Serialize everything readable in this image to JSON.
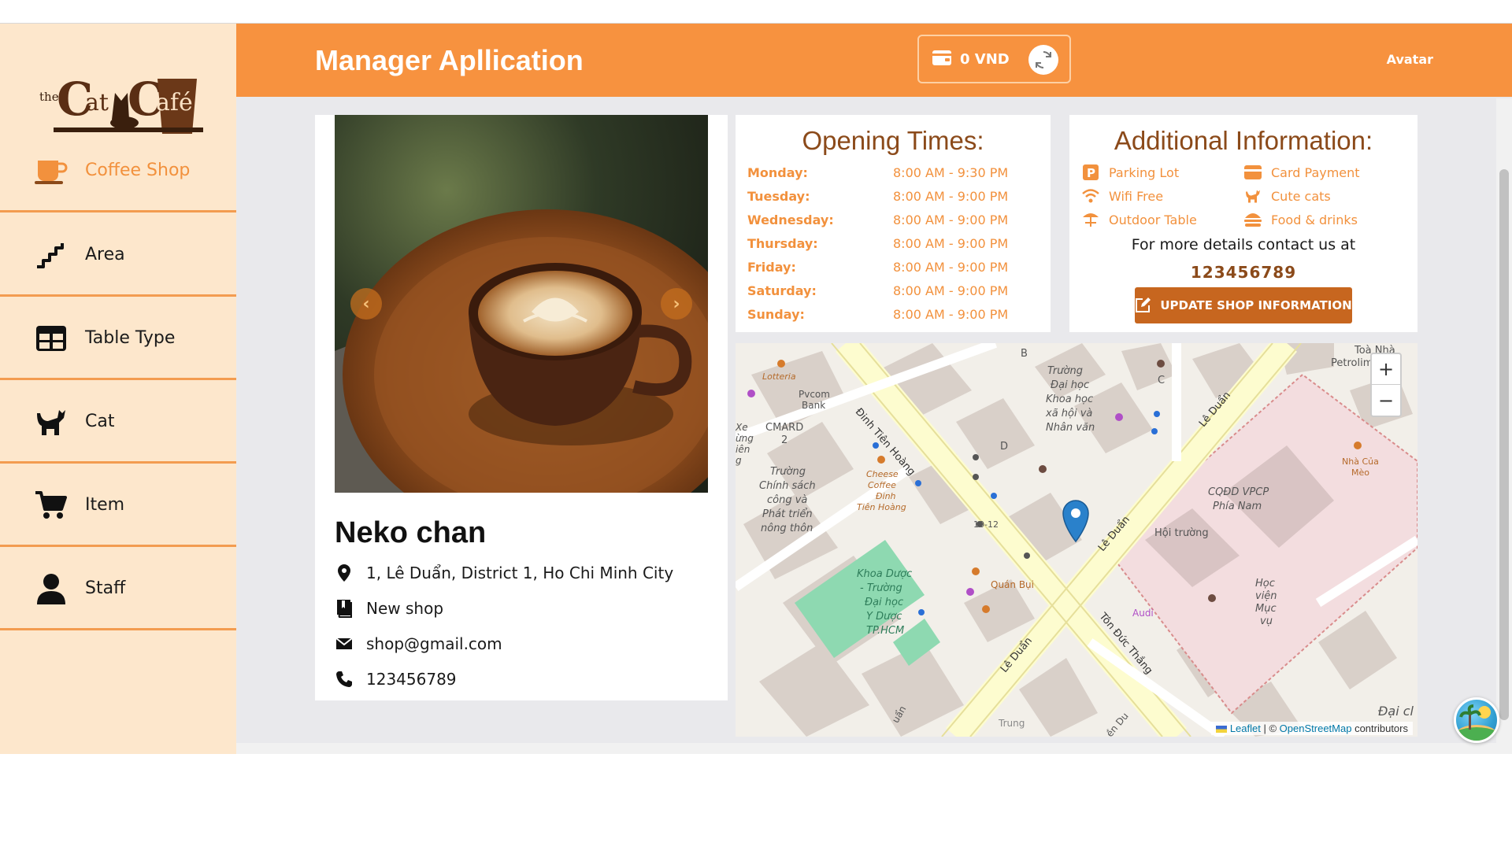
{
  "header": {
    "title": "Manager Apllication",
    "wallet_amount": "0 VND",
    "avatar_label": "Avatar"
  },
  "sidebar": {
    "items": [
      {
        "label": "Coffee Shop",
        "icon": "coffee-cup-icon",
        "active": true
      },
      {
        "label": "Area",
        "icon": "stairs-icon",
        "active": false
      },
      {
        "label": "Table Type",
        "icon": "table-grid-icon",
        "active": false
      },
      {
        "label": "Cat",
        "icon": "cat-icon",
        "active": false
      },
      {
        "label": "Item",
        "icon": "cart-icon",
        "active": false
      },
      {
        "label": "Staff",
        "icon": "user-icon",
        "active": false
      }
    ]
  },
  "shop": {
    "name": "Neko chan",
    "address": "1, Lê Duẩn, District 1, Ho Chi Minh City",
    "description": "New shop",
    "email": "shop@gmail.com",
    "phone": "123456789"
  },
  "opening": {
    "title": "Opening Times:",
    "days": [
      {
        "day": "Monday:",
        "time": "8:00 AM - 9:30 PM"
      },
      {
        "day": "Tuesday:",
        "time": "8:00 AM - 9:00 PM"
      },
      {
        "day": "Wednesday:",
        "time": "8:00 AM - 9:00 PM"
      },
      {
        "day": "Thursday:",
        "time": "8:00 AM - 9:00 PM"
      },
      {
        "day": "Friday:",
        "time": "8:00 AM - 9:00 PM"
      },
      {
        "day": "Saturday:",
        "time": "8:00 AM - 9:00 PM"
      },
      {
        "day": "Sunday:",
        "time": "8:00 AM - 9:00 PM"
      }
    ]
  },
  "additional": {
    "title": "Additional Information:",
    "features": [
      {
        "label": "Parking Lot",
        "icon": "parking-icon"
      },
      {
        "label": "Card Payment",
        "icon": "card-icon"
      },
      {
        "label": "Wifi Free",
        "icon": "wifi-icon"
      },
      {
        "label": "Cute cats",
        "icon": "cat-icon"
      },
      {
        "label": "Outdoor Table",
        "icon": "umbrella-table-icon"
      },
      {
        "label": "Food & drinks",
        "icon": "burger-icon"
      }
    ],
    "contact_text": "For more details contact us at",
    "contact_phone": "123456789",
    "update_button": "UPDATE SHOP INFORMATION"
  },
  "map": {
    "zoom_in": "+",
    "zoom_out": "−",
    "attribution_leaflet": "Leaflet",
    "attribution_sep": " | © ",
    "attribution_osm": "OpenStreetMap",
    "attribution_tail": " contributors",
    "labels": {
      "lotteria": "Lotteria",
      "pvcom": "Pvcom",
      "bank": "Bank",
      "cmard": "CMARD",
      "cmard_num": "2",
      "dinh_tien_hoang": "Đinh Tiên Hoàng",
      "le_duan_1": "Lê Duẩn",
      "le_duan_2": "Lê Duẩn",
      "le_duan_3": "Lê Duẩn",
      "ton_duc_thang": "Tôn Đức Thắng",
      "truong_1": "Trường",
      "truong_2": "Đại học",
      "truong_3": "Khoa học",
      "truong_4": "xã hội và",
      "truong_5": "Nhân văn",
      "chinh_1": "Chính sách",
      "chinh_2": "công và",
      "chinh_3": "Phát triển",
      "chinh_4": "nông thôn",
      "chinh_0": "Trường",
      "cheese_1": "Cheese",
      "cheese_2": "Coffee",
      "cheese_3": "Đinh",
      "cheese_4": "Tiên Hoàng",
      "khoa_1": "Khoa Dược",
      "khoa_2": "- Trường",
      "khoa_3": "Đại học",
      "khoa_4": "Y Dược",
      "khoa_5": "TP.HCM",
      "cqdd_1": "CQĐD VPCP",
      "cqdd_2": "Phía Nam",
      "hoi_truong": "Hội trường",
      "hoc_1": "Học",
      "hoc_2": "viện",
      "hoc_3": "Mục",
      "hoc_4": "vụ",
      "quan_bui": "Quán Bụi",
      "audi": "Audi",
      "toa_1": "Toà Nhà",
      "toa_2": "Petrolimex",
      "nha_1": "Nhà Của",
      "nha_2": "Mèo",
      "num_10_12": "10-12",
      "b": "B",
      "c": "C",
      "d": "D",
      "dai_ch": "Đại cl",
      "trung": "Trung",
      "xe": "Xe",
      "ung": "ừng",
      "ien": "iên",
      "g": "g",
      "uan": "uẩn",
      "en_du": "ền Du"
    }
  },
  "colors": {
    "accent": "#f7923f",
    "sidebar_bg": "#fde7cc",
    "brown": "#8b4a1a",
    "button": "#c7661f"
  }
}
